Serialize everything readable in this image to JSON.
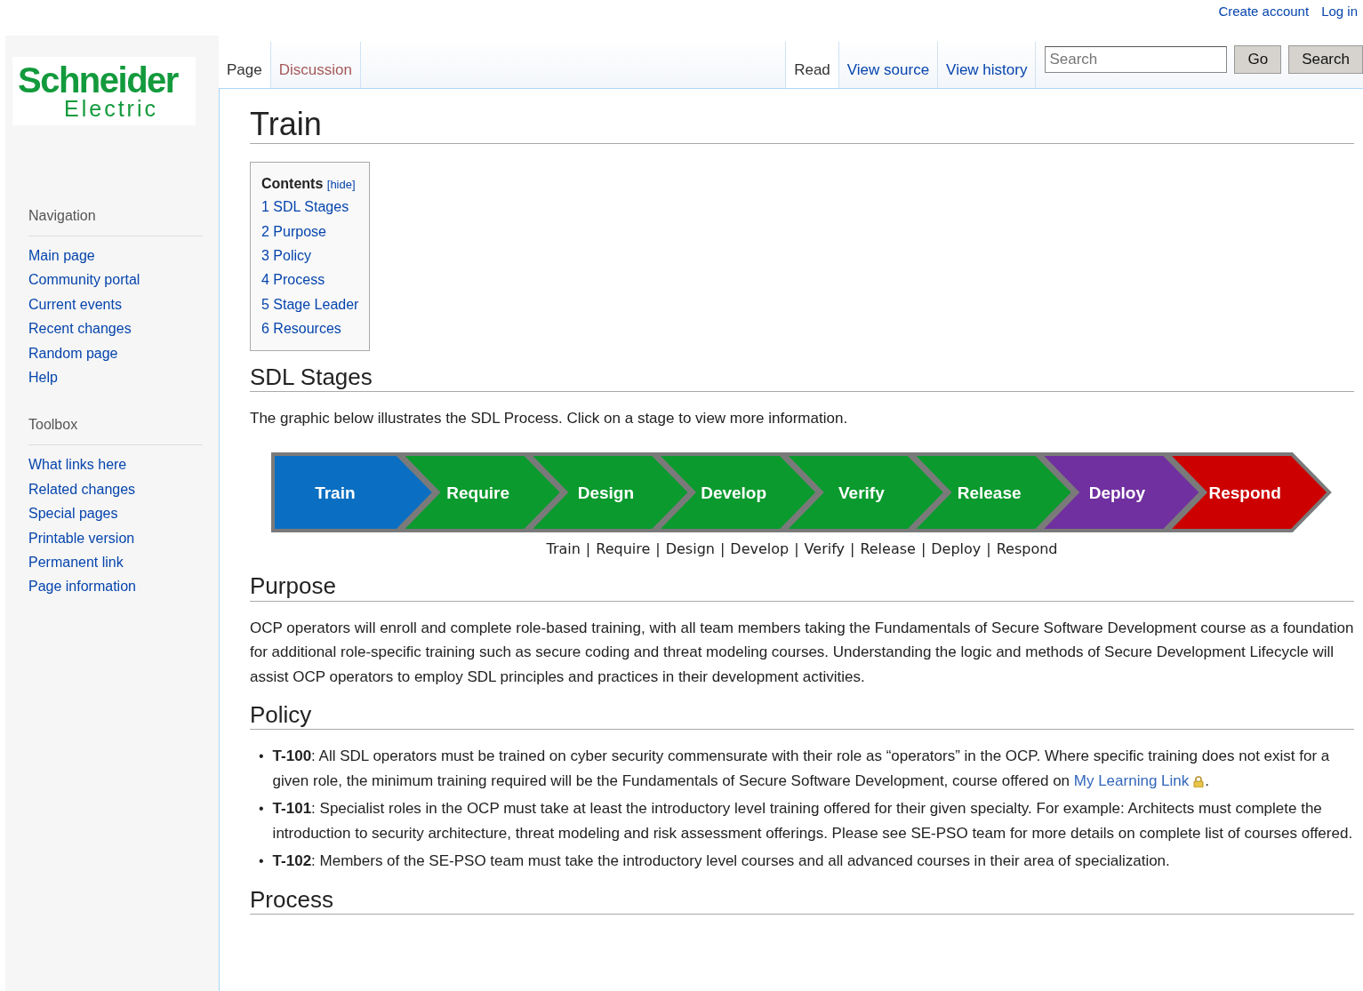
{
  "personal_tools": [
    "Create account",
    "Log in"
  ],
  "logo": {
    "line1": "Schneider",
    "line2": "Electric"
  },
  "left_tabs": [
    {
      "label": "Page",
      "selected": true
    },
    {
      "label": "Discussion",
      "selected": false
    }
  ],
  "right_tabs": [
    {
      "label": "Read",
      "selected": true
    },
    {
      "label": "View source",
      "selected": false
    },
    {
      "label": "View history",
      "selected": false
    }
  ],
  "search": {
    "placeholder": "Search",
    "buttons": [
      "Go",
      "Search"
    ]
  },
  "sidebar": [
    {
      "heading": "Navigation",
      "items": [
        "Main page",
        "Community portal",
        "Current events",
        "Recent changes",
        "Random page",
        "Help"
      ]
    },
    {
      "heading": "Toolbox",
      "items": [
        "What links here",
        "Related changes",
        "Special pages",
        "Printable version",
        "Permanent link",
        "Page information"
      ]
    }
  ],
  "title": "Train",
  "toc": {
    "title": "Contents",
    "toggle": "[hide]",
    "items": [
      {
        "number": "1",
        "label": "SDL Stages"
      },
      {
        "number": "2",
        "label": "Purpose"
      },
      {
        "number": "3",
        "label": "Policy"
      },
      {
        "number": "4",
        "label": "Process"
      },
      {
        "number": "5",
        "label": "Stage Leader"
      },
      {
        "number": "6",
        "label": "Resources"
      }
    ]
  },
  "sections": [
    {
      "kind": "stages",
      "heading": "SDL Stages",
      "intro": "The graphic below illustrates the SDL Process. Click on a stage to view more information.",
      "stages": [
        {
          "label": "Train",
          "color": "#0a6fc2"
        },
        {
          "label": "Require",
          "color": "#0b9a2e"
        },
        {
          "label": "Design",
          "color": "#0b9a2e"
        },
        {
          "label": "Develop",
          "color": "#0b9a2e"
        },
        {
          "label": "Verify",
          "color": "#0b9a2e"
        },
        {
          "label": "Release",
          "color": "#0b9a2e"
        },
        {
          "label": "Deploy",
          "color": "#7030a0"
        },
        {
          "label": "Respond",
          "color": "#cc0000"
        }
      ],
      "links": [
        "Train",
        "Require",
        "Design",
        "Develop",
        "Verify",
        "Release",
        "Deploy",
        "Respond"
      ],
      "separator": "|"
    },
    {
      "kind": "text",
      "heading": "Purpose",
      "text": "OCP operators will enroll and complete role-based training, with all team members taking the Fundamentals of Secure Software Development course as a foundation for additional role-specific training such as secure coding and threat modeling courses. Understanding the logic and methods of Secure Development Lifecycle will assist OCP operators to employ SDL principles and practices in their development activities."
    },
    {
      "kind": "list",
      "heading": "Policy",
      "bullet": "•",
      "items": [
        {
          "text": "**T-100**: All SDL operators must be trained on cyber security commensurate with their role as “operators” in the OCP. Where specific training does not exist for a given role, the minimum training required will be the Fundamentals of Secure Software Development, course offered on ",
          "link": "My Learning Link",
          "after": "."
        },
        {
          "text": "**T-101**: Specialist roles in the OCP must take at least the introductory level training offered for their given specialty. For example: Architects must complete the introduction to security architecture, threat modeling and risk assessment offerings. Please see SE-PSO team for more details on complete list of courses offered."
        },
        {
          "text": "**T-102**: Members of the SE-PSO team must take the introductory level courses and all advanced courses in their area of specialization."
        }
      ]
    },
    {
      "kind": "heading",
      "heading": "Process"
    }
  ]
}
